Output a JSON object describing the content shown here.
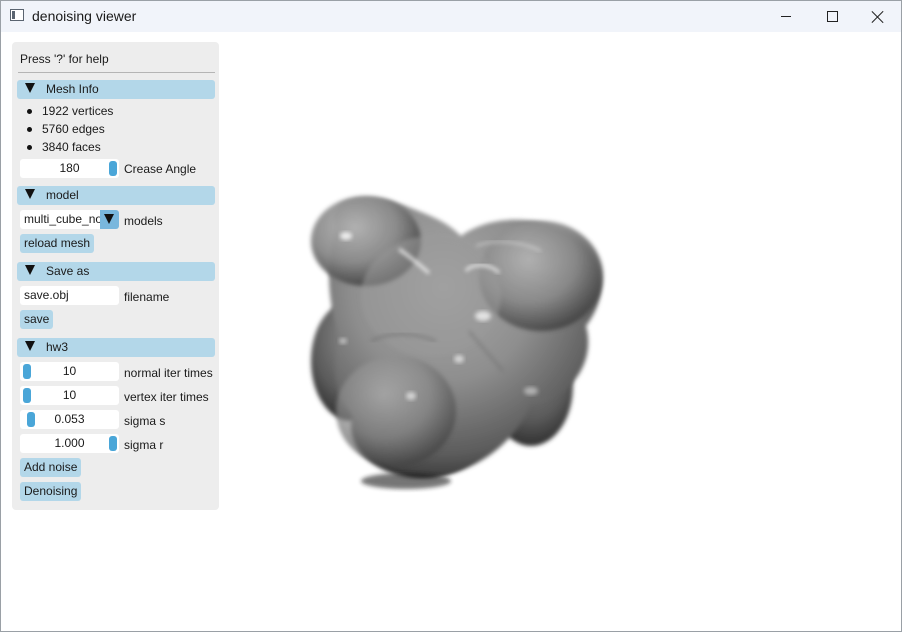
{
  "window": {
    "title": "denoising viewer"
  },
  "panel": {
    "help_text": "Press '?' for help",
    "mesh_info": {
      "header": "Mesh Info",
      "stats": [
        "1922 vertices",
        "5760 edges",
        "3840 faces"
      ],
      "crease_angle": {
        "value": "180",
        "label": "Crease Angle",
        "fraction": 1.0
      }
    },
    "model": {
      "header": "model",
      "selected": "multi_cube_noi",
      "label": "models",
      "reload_label": "reload mesh"
    },
    "save_as": {
      "header": "Save as",
      "filename_value": "save.obj",
      "filename_label": "filename",
      "save_label": "save"
    },
    "hw3": {
      "header": "hw3",
      "normal_iter": {
        "value": "10",
        "label": "normal iter times",
        "fraction": 0.0
      },
      "vertex_iter": {
        "value": "10",
        "label": "vertex iter times",
        "fraction": 0.0
      },
      "sigma_s": {
        "value": "0.053",
        "label": "sigma s",
        "fraction": 0.05
      },
      "sigma_r": {
        "value": "1.000",
        "label": "sigma r",
        "fraction": 1.0
      },
      "add_noise_label": "Add noise",
      "denoising_label": "Denoising"
    }
  },
  "viewport": {
    "background": "#ffffff",
    "mesh_color": "#8a8a8a"
  }
}
